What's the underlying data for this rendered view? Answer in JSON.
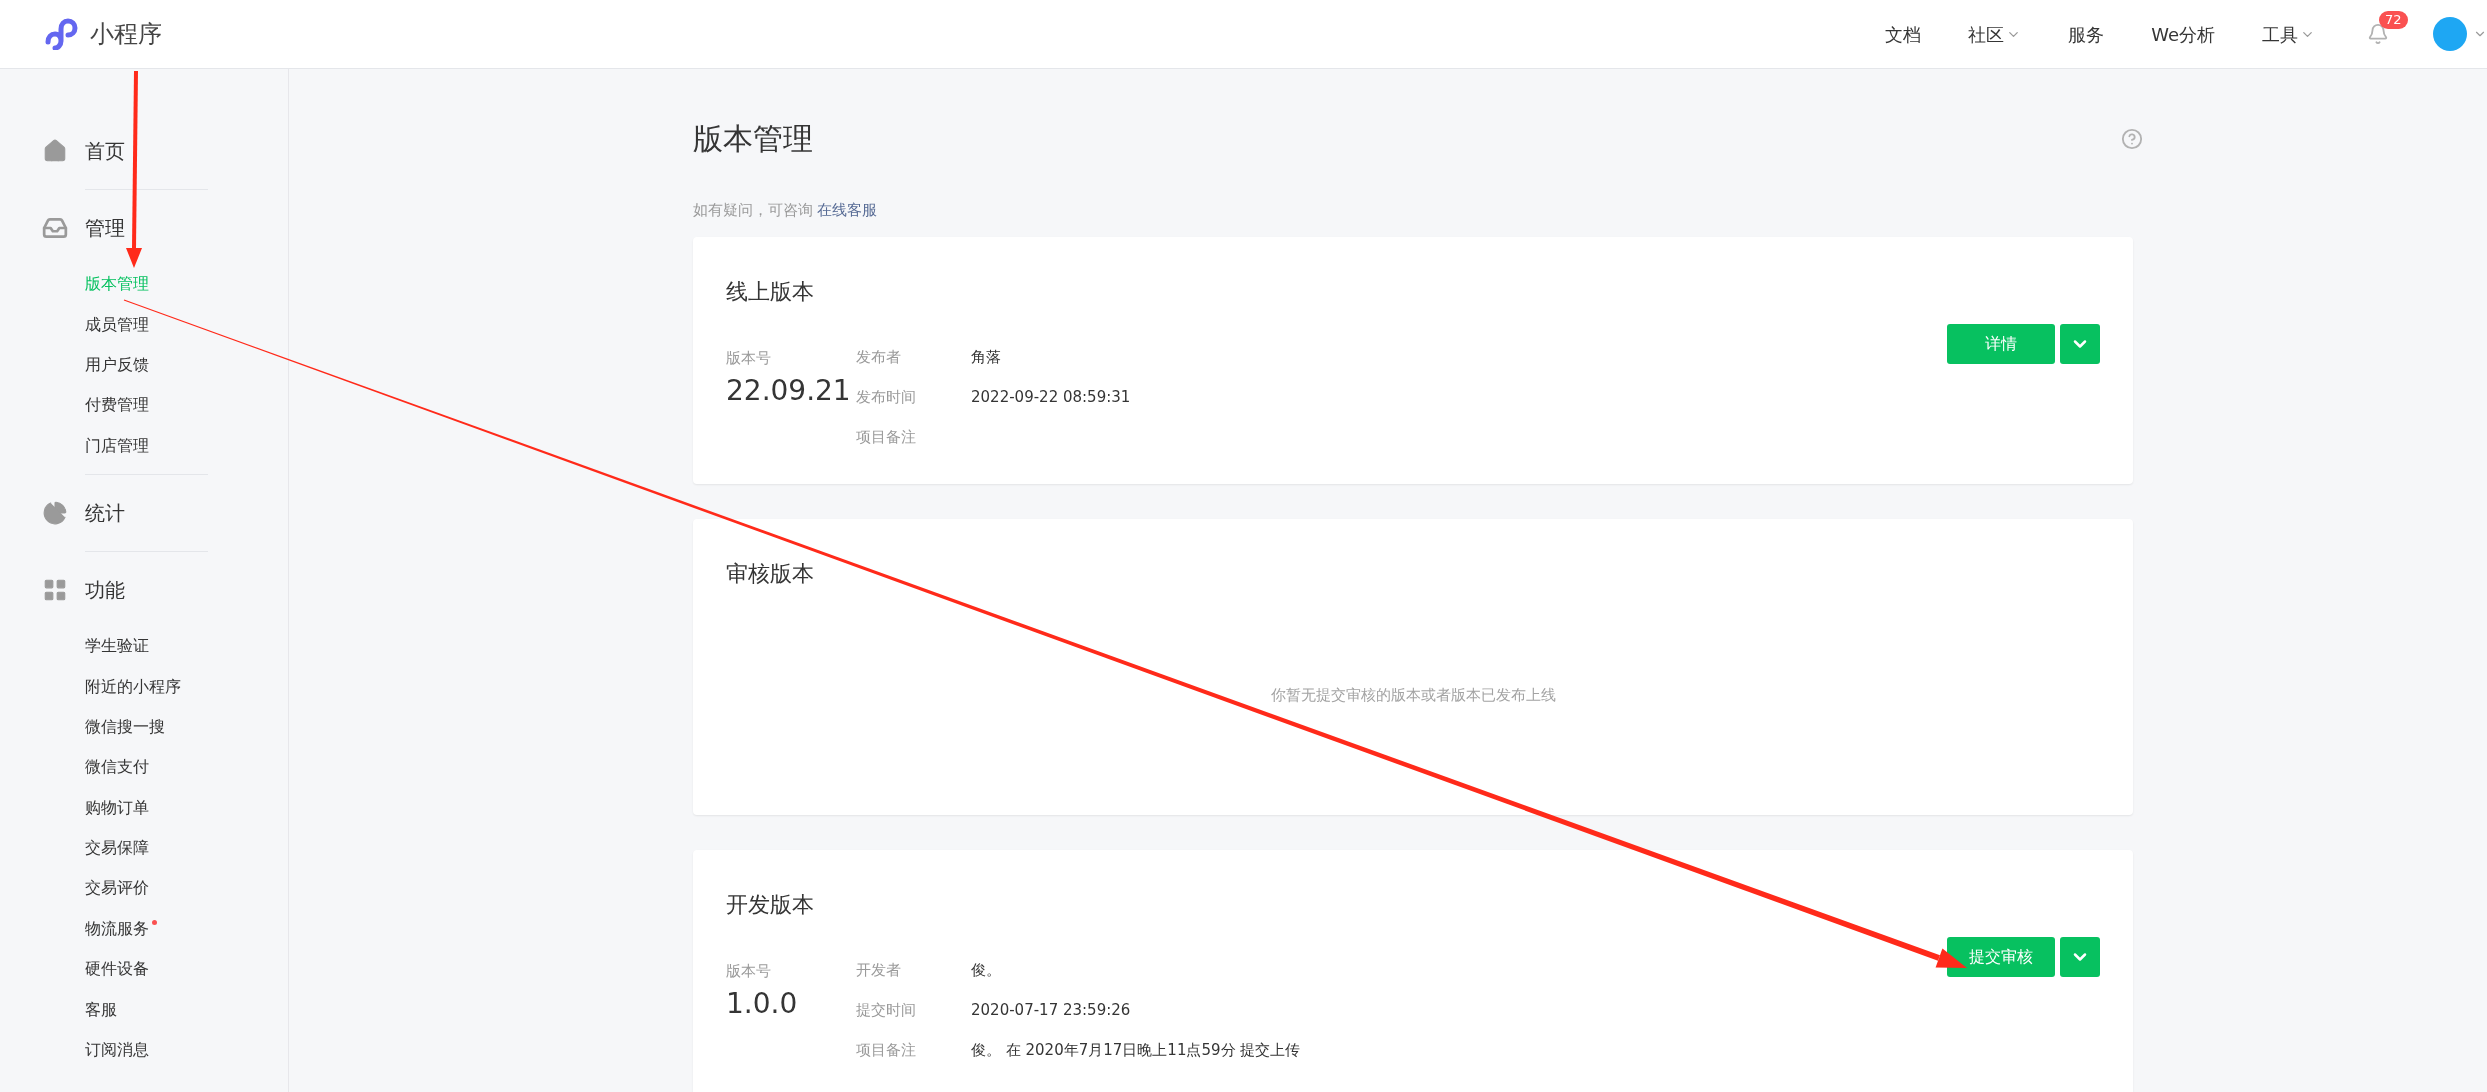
{
  "header": {
    "logo": "小程序",
    "nav": [
      {
        "label": "文档",
        "dropdown": false
      },
      {
        "label": "社区",
        "dropdown": true
      },
      {
        "label": "服务",
        "dropdown": false
      },
      {
        "label": "We分析",
        "dropdown": false
      },
      {
        "label": "工具",
        "dropdown": true
      }
    ],
    "notifications": {
      "count": "72"
    }
  },
  "sidebar": {
    "sections": [
      {
        "kind": "home",
        "label": "首页"
      },
      {
        "kind": "inbox",
        "label": "管理",
        "children": [
          {
            "label": "版本管理",
            "selected": true,
            "new": false
          },
          {
            "label": "成员管理",
            "selected": false,
            "new": false
          },
          {
            "label": "用户反馈",
            "selected": false,
            "new": false
          },
          {
            "label": "付费管理",
            "selected": false,
            "new": false
          },
          {
            "label": "门店管理",
            "selected": false,
            "new": false
          }
        ]
      },
      {
        "kind": "pie",
        "label": "统计"
      },
      {
        "kind": "grid",
        "label": "功能",
        "children": [
          {
            "label": "学生验证",
            "selected": false,
            "new": false
          },
          {
            "label": "附近的小程序",
            "selected": false,
            "new": false
          },
          {
            "label": "微信搜一搜",
            "selected": false,
            "new": false
          },
          {
            "label": "微信支付",
            "selected": false,
            "new": false
          },
          {
            "label": "购物订单",
            "selected": false,
            "new": false
          },
          {
            "label": "交易保障",
            "selected": false,
            "new": false
          },
          {
            "label": "交易评价",
            "selected": false,
            "new": false
          },
          {
            "label": "物流服务",
            "selected": false,
            "new": true
          },
          {
            "label": "硬件设备",
            "selected": false,
            "new": false
          },
          {
            "label": "客服",
            "selected": false,
            "new": false
          },
          {
            "label": "订阅消息",
            "selected": false,
            "new": false
          }
        ]
      }
    ]
  },
  "main": {
    "title": "版本管理",
    "hint": {
      "text": "如有疑问，可咨询",
      "link": "在线客服"
    },
    "cards": [
      {
        "kind": "version",
        "title": "线上版本",
        "version_label": "版本号",
        "version": "22.09.21",
        "fields": [
          {
            "label": "发布者",
            "value": "角落"
          },
          {
            "label": "发布时间",
            "value": "2022-09-22 08:59:31"
          },
          {
            "label": "项目备注"
          }
        ],
        "button": "详情"
      },
      {
        "kind": "empty",
        "title": "审核版本",
        "message": "你暂无提交审核的版本或者版本已发布上线"
      },
      {
        "kind": "version",
        "title": "开发版本",
        "version_label": "版本号",
        "version": "1.0.0",
        "fields": [
          {
            "label": "开发者",
            "value": "俊。"
          },
          {
            "label": "提交时间",
            "value": "2020-07-17 23:59:26"
          },
          {
            "label": "项目备注",
            "value": "俊。 在 2020年7月17日晚上11点59分 提交上传"
          }
        ],
        "button": "提交审核"
      }
    ]
  }
}
